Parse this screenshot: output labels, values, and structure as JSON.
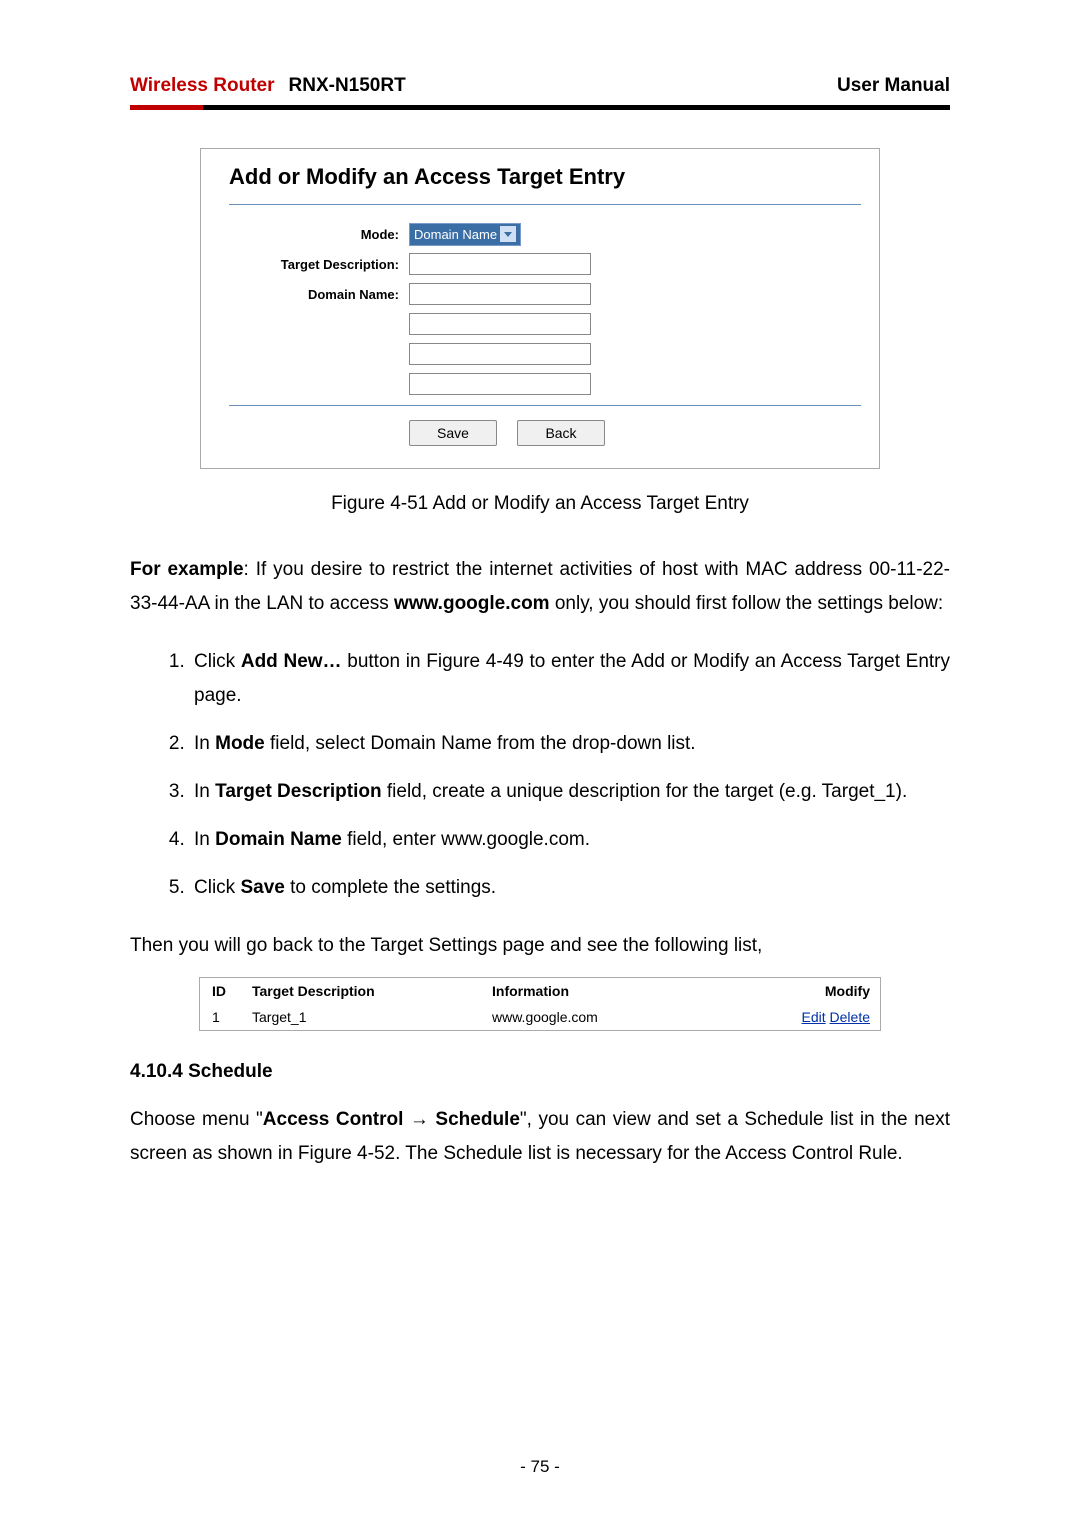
{
  "header": {
    "brand": "Wireless Router",
    "model": "RNX-N150RT",
    "right": "User Manual"
  },
  "figure": {
    "title": "Add or Modify an Access Target Entry",
    "labels": {
      "mode": "Mode:",
      "target_desc": "Target Description:",
      "domain_name": "Domain Name:"
    },
    "mode_value": "Domain Name",
    "buttons": {
      "save": "Save",
      "back": "Back"
    }
  },
  "caption": "Figure 4-51    Add or Modify an Access Target Entry",
  "example": {
    "lead_bold": "For example",
    "lead_rest": ": If you desire to restrict the internet activities of host with MAC address 00-11-22-33-44-AA in the LAN to access ",
    "url_bold": "www.google.com",
    "tail": " only, you should first follow the settings below:"
  },
  "steps": {
    "s1a": "Click ",
    "s1b": "Add New…",
    "s1c": " button in Figure 4-49 to enter the Add or Modify an Access Target Entry page.",
    "s2a": "In ",
    "s2b": "Mode",
    "s2c": " field, select Domain Name from the drop-down list.",
    "s3a": "In ",
    "s3b": "Target Description",
    "s3c": " field, create a unique description for the target (e.g. Target_1).",
    "s4a": "In ",
    "s4b": "Domain Name",
    "s4c": " field, enter www.google.com.",
    "s5a": "Click ",
    "s5b": "Save",
    "s5c": " to complete the settings."
  },
  "after_steps": "Then you will go back to the Target Settings page and see the following list,",
  "table": {
    "head": {
      "id": "ID",
      "desc": "Target Description",
      "info": "Information",
      "mod": "Modify"
    },
    "row": {
      "id": "1",
      "desc": "Target_1",
      "info": "www.google.com",
      "edit": "Edit",
      "del": "Delete"
    }
  },
  "section": {
    "num": "4.10.4 ",
    "title": "Schedule",
    "p_a": "Choose menu \"",
    "p_b": "Access Control → Schedule",
    "p_c": "\", you can view and set a Schedule list in the next screen as shown in Figure 4-52. The Schedule list is necessary for the Access Control Rule."
  },
  "page_num": "- 75 -"
}
